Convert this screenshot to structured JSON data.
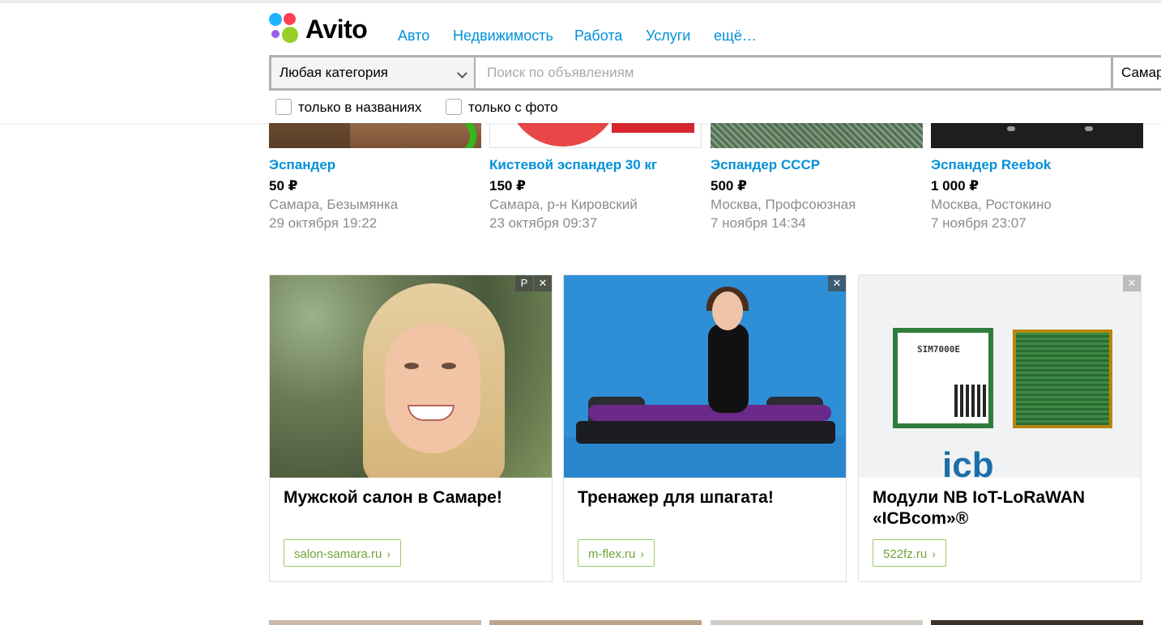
{
  "header": {
    "logo_text": "Avito",
    "nav": [
      "Авто",
      "Недвижимость",
      "Работа",
      "Услуги",
      "ещё…"
    ],
    "search": {
      "category": "Любая категория",
      "placeholder": "Поиск по объявлениям",
      "city": "Самар"
    },
    "filters": [
      "только в названиях",
      "только с фото"
    ]
  },
  "listings": [
    {
      "title": "Эспандер",
      "price": "50 ₽",
      "location": "Самара, Безымянка",
      "date": "29 октября 19:22"
    },
    {
      "title": "Кистевой эспандер 30 кг",
      "price": "150 ₽",
      "location": "Самара, р-н Кировский",
      "date": "23 октября 09:37"
    },
    {
      "title": "Эспандер СССР",
      "price": "500 ₽",
      "location": "Москва, Профсоюзная",
      "date": "7 ноября 14:34"
    },
    {
      "title": "Эспандер Reebok",
      "price": "1 000 ₽",
      "location": "Москва, Ростокино",
      "date": "7 ноября 23:07"
    }
  ],
  "ads": [
    {
      "headline": "Мужской салон в Самаре!",
      "link": "salon-samara.ru",
      "badge": "Р"
    },
    {
      "headline": "Тренажер для шпагата!",
      "link": "m-flex.ru"
    },
    {
      "headline": "Модули NB IoT-LoRaWAN «ICBcom»®",
      "link": "522fz.ru",
      "chip_label": "SIM7000E",
      "brand": "icb"
    }
  ],
  "colors": {
    "link_blue": "#0091d9",
    "ad_link_green": "#6fa33a",
    "muted_text": "#8c8c8c"
  }
}
